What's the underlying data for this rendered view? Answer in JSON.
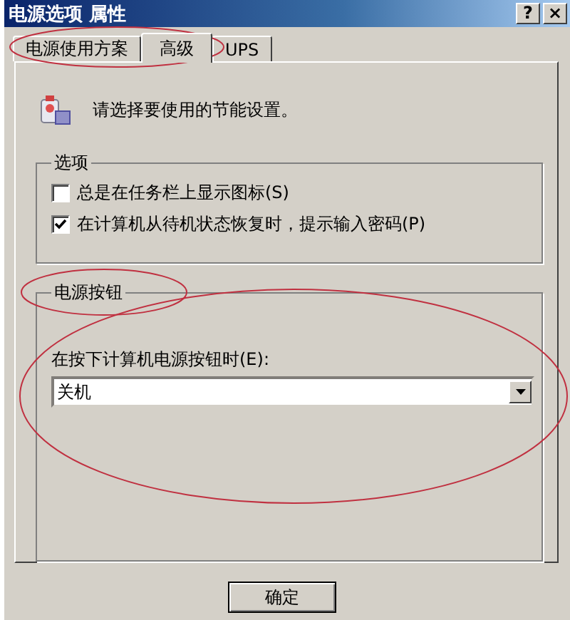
{
  "window": {
    "title": "电源选项 属性",
    "help_button": "?",
    "close_button": "×"
  },
  "tabs": [
    {
      "label": "电源使用方案",
      "selected": false
    },
    {
      "label": "高级",
      "selected": true
    },
    {
      "label": "UPS",
      "selected": false
    }
  ],
  "intro": "请选择要使用的节能设置。",
  "options": {
    "title": "选项",
    "checkboxes": [
      {
        "label": "总是在任务栏上显示图标(S)",
        "checked": false
      },
      {
        "label": "在计算机从待机状态恢复时，提示输入密码(P)",
        "checked": true
      }
    ]
  },
  "power_buttons": {
    "title": "电源按钮",
    "label": "在按下计算机电源按钮时(E):",
    "dropdown": {
      "value": "关机"
    }
  },
  "buttons": [
    "确定"
  ]
}
